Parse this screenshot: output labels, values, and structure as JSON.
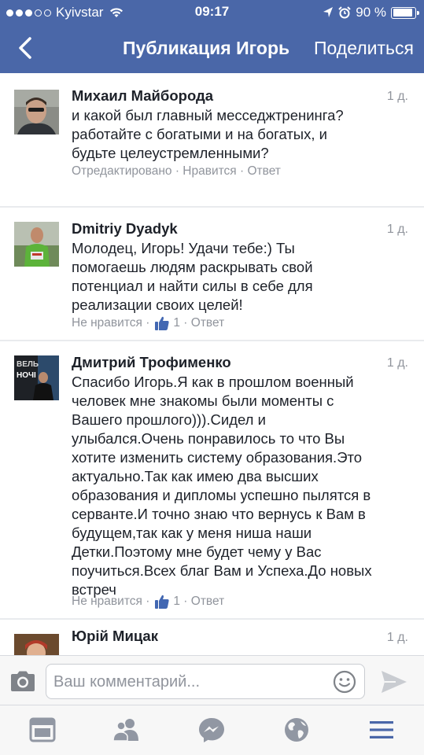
{
  "status_bar": {
    "carrier": "Kyivstar",
    "time": "09:17",
    "battery_text": "90 %",
    "battery_level": 0.9
  },
  "nav": {
    "back_icon": "chevron-left-icon",
    "title": "Публикация Игорь",
    "share_label": "Поделиться"
  },
  "comments": [
    {
      "author": "Михаил Майборода",
      "time": "1 д.",
      "text": "и какой был главный месседжтренинга?\nработайте с богатыми и на богатых, и\nбудьте целеустремленными?",
      "meta": "Отредактировано · Нравится · Ответ"
    },
    {
      "author": "Dmitriy Dyadyk",
      "time": "1 д.",
      "text": "Молодец, Игорь! Удачи тебе:) Ты\nпомогаешь людям раскрывать свой\nпотенциал и найти силы в себе для\nреализации своих целей!",
      "meta_left": "Не нравится ·",
      "like_count": "1",
      "meta_right": "· Ответ"
    },
    {
      "author": "Дмитрий Трофименко",
      "time": "1 д.",
      "avatar_text": "ВЕЛЬ\nНОЧІ",
      "text": "Спасибо Игорь.Я как в прошлом военный\nчеловек мне знакомы были моменты  с\nВашего прошлого))).Сидел и\nулыбался.Очень понравилось то что Вы\nхотите изменить систему образования.Это\nактуально.Так как имею два высших\nобразования и дипломы успешно пылятся в\nсерванте.И точно знаю что вернусь к Вам в\nбудущем,так как у меня ниша наши\nДетки.Поэтому мне будет чему у Вас\nпоучиться.Всех благ Вам и Успеха.До новых\nвстреч",
      "meta_left": "Не нравится ·",
      "like_count": "1",
      "meta_right": "· Ответ"
    },
    {
      "author": "Юрій Мицак",
      "time": "1 д."
    }
  ],
  "composer": {
    "placeholder": "Ваш комментарий..."
  },
  "tabs": [
    {
      "icon": "news-feed-icon"
    },
    {
      "icon": "friends-icon"
    },
    {
      "icon": "messenger-icon"
    },
    {
      "icon": "globe-icon"
    },
    {
      "icon": "menu-icon"
    }
  ],
  "colors": {
    "header": "#4a67a8",
    "like_blue": "#4267b2",
    "meta_gray": "#90949c"
  }
}
